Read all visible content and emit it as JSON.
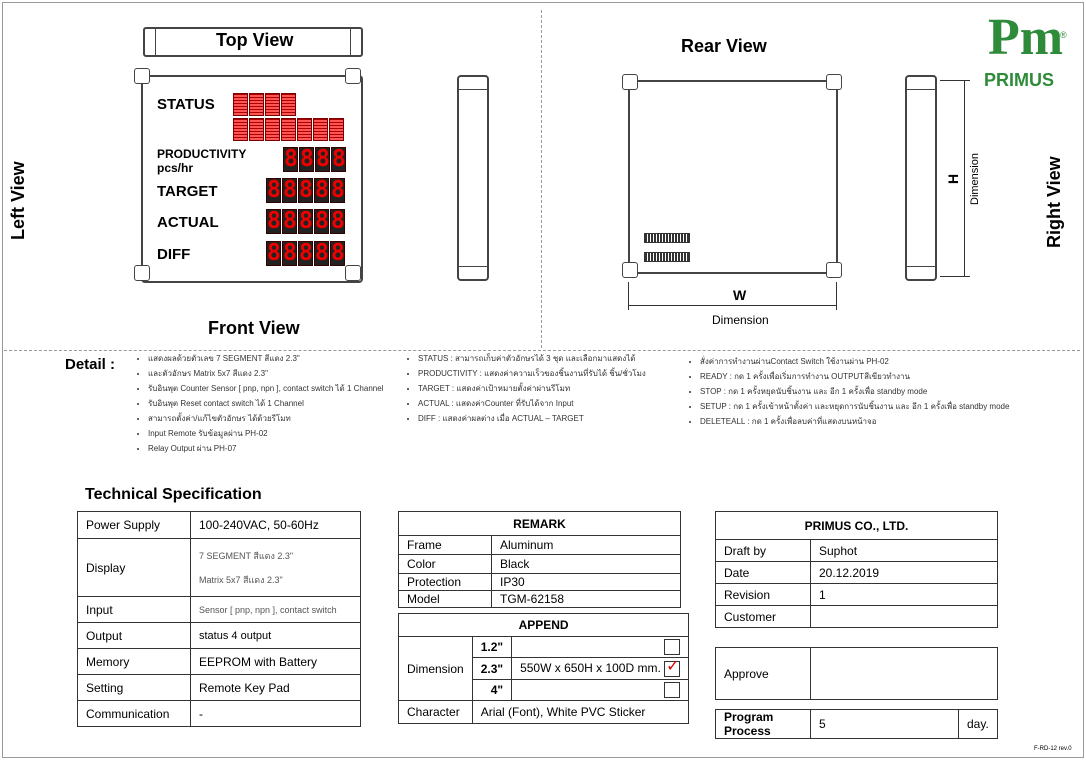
{
  "views": {
    "top": "Top View",
    "front": "Front View",
    "left": "Left View",
    "rear": "Rear View",
    "right": "Right View"
  },
  "panel": {
    "status": "STATUS",
    "productivity": "PRODUCTIVITY",
    "unit": "pcs/hr",
    "target": "TARGET",
    "actual": "ACTUAL",
    "diff": "DIFF"
  },
  "dimension": {
    "w": "W",
    "h": "H",
    "label": "Dimension"
  },
  "logo": {
    "name": "PRIMUS",
    "mark": "Pm",
    "reg": "®"
  },
  "detail": {
    "title": "Detail :",
    "col1": [
      "แสดงผลด้วยตัวเลข 7 SEGMENT สีแดง 2.3\"",
      "และตัวอักษร Matrix 5x7 สีแดง 2.3\"",
      "รับอินพุต Counter Sensor [ pnp, npn ], contact switch ได้ 1 Channel",
      "รับอินพุต Reset contact switch ได้ 1 Channel",
      "สามารถตั้งค่า/แก้ไขตัวอักษร ได้ด้วยรีโมท",
      "Input Remote รับข้อมูลผ่าน PH-02",
      "Relay Output ผ่าน PH-07"
    ],
    "col2": [
      "STATUS : สามารถเก็บค่าตัวอักษรได้ 3 ชุด และเลือกมาแสดงได้",
      "PRODUCTIVITY : แสดงค่าความเร็วของชิ้นงานที่รับได้ ชิ้น/ชั่วโมง",
      "TARGET : แสดงค่าเป้าหมายตั้งค่าผ่านรีโมท",
      "ACTUAL : แสดงค่าCounter ที่รับได้จาก Input",
      "DIFF : แสดงค่าผลต่าง เมื่อ ACTUAL – TARGET"
    ],
    "col3": [
      "สั่งค่าการทำงานผ่านContact Switch ใช้งานผ่าน PH-02",
      "READY : กด 1 ครั้งเพื่อเริ่มการทำงาน OUTPUTสีเขียวทำงาน",
      "STOP : กด 1 ครั้งหยุดนับชิ้นงาน และ อีก 1 ครั้งเพื่อ standby mode",
      "SETUP : กด 1 ครั้งเข้าหน้าตั้งค่า และหยุดการนับชิ้นงาน และ อีก 1 ครั้งเพื่อ standby mode",
      "DELETEALL : กด 1 ครั้งเพื่อลบค่าที่แสดงบนหน้าจอ"
    ]
  },
  "tech": {
    "title": "Technical Specification",
    "rows": [
      {
        "k": "Power Supply",
        "v": "100-240VAC, 50-60Hz"
      },
      {
        "k": "Display",
        "v1": "7 SEGMENT สีแดง 2.3\"",
        "v2": "Matrix 5x7 สีแดง 2.3\""
      },
      {
        "k": "Input",
        "v": "Sensor [ pnp, npn ], contact switch"
      },
      {
        "k": "Output",
        "v": "status 4 output"
      },
      {
        "k": "Memory",
        "v": "EEPROM with Battery"
      },
      {
        "k": "Setting",
        "v": "Remote Key Pad"
      },
      {
        "k": "Communication",
        "v": "-"
      }
    ]
  },
  "remark": {
    "title": "REMARK",
    "rows": [
      {
        "k": "Frame",
        "v": "Aluminum"
      },
      {
        "k": "Color",
        "v": "Black"
      },
      {
        "k": "Protection",
        "v": "IP30"
      },
      {
        "k": "Model",
        "v": "TGM-62158"
      }
    ]
  },
  "append": {
    "title": "APPEND",
    "dimension_label": "Dimension",
    "sizes": [
      "1.2\"",
      "2.3\"",
      "4\""
    ],
    "size_values": [
      "",
      "550W x 650H x 100D mm.",
      ""
    ],
    "checked_index": 1,
    "character_label": "Character",
    "character_value": "Arial (Font), White PVC Sticker"
  },
  "company": {
    "title": "PRIMUS CO., LTD.",
    "rows": [
      {
        "k": "Draft by",
        "v": "Suphot"
      },
      {
        "k": "Date",
        "v": "20.12.2019"
      },
      {
        "k": "Revision",
        "v": "1"
      },
      {
        "k": "Customer",
        "v": ""
      }
    ],
    "approve": "Approve",
    "program_process": "Program Process",
    "program_days": "5",
    "days_unit": "day."
  },
  "form_code": "F-RD-12 rev.0",
  "colors": {
    "brand_green": "#2e8b3a",
    "led_red": "#e00000"
  }
}
